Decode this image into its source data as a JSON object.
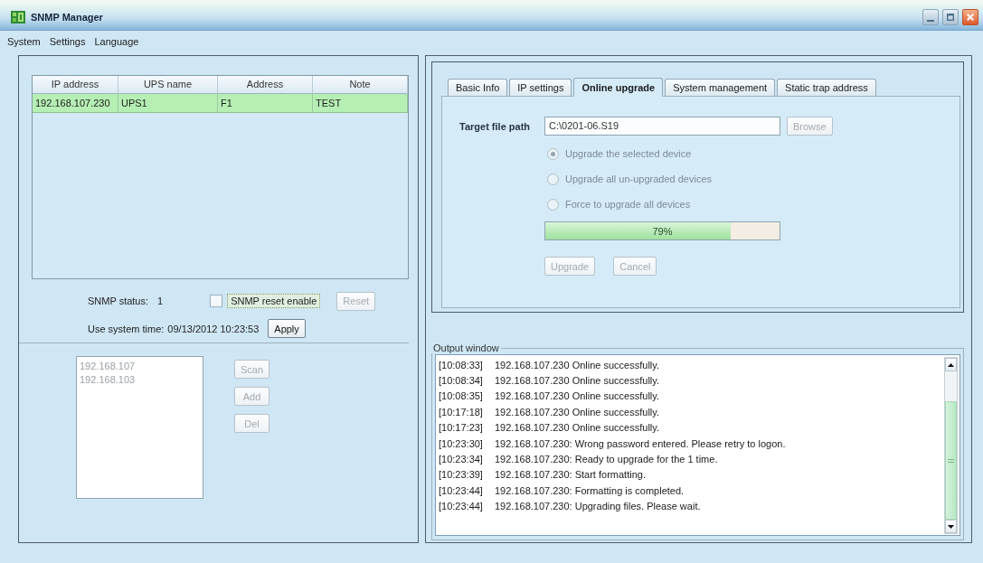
{
  "window": {
    "title": "SNMP Manager"
  },
  "menu": [
    {
      "label": "System"
    },
    {
      "label": "Settings"
    },
    {
      "label": "Language"
    }
  ],
  "device_table": {
    "columns": [
      "IP address",
      "UPS name",
      "Address",
      "Note"
    ],
    "rows": [
      {
        "cells": [
          "192.168.107.230",
          "UPS1",
          "F1",
          "TEST"
        ],
        "selected": true
      }
    ]
  },
  "snmp_status": {
    "label": "SNMP status:",
    "value": "1"
  },
  "reset_enable": {
    "label": "SNMP reset enable",
    "checked": false,
    "focused": true
  },
  "reset_button": {
    "label": "Reset",
    "disabled": true
  },
  "system_time": {
    "label": "Use system time:",
    "value": "09/13/2012 10:23:53"
  },
  "apply_button": {
    "label": "Apply",
    "disabled": false
  },
  "ip_list": {
    "disabled": true,
    "items": [
      "192.168.107",
      "192.168.103"
    ]
  },
  "ip_list_buttons": [
    {
      "label": "Scan",
      "disabled": true
    },
    {
      "label": "Add",
      "disabled": true
    },
    {
      "label": "Del",
      "disabled": true
    }
  ],
  "tabs": [
    {
      "label": "Basic Info",
      "selected": false
    },
    {
      "label": "IP settings",
      "selected": false
    },
    {
      "label": "Online upgrade",
      "selected": true
    },
    {
      "label": "System management",
      "selected": false
    },
    {
      "label": "Static trap address",
      "selected": false
    }
  ],
  "online_upgrade": {
    "target_label": "Target file path",
    "target_value": "C:\\0201-06.S19",
    "browse_button": {
      "label": "Browse",
      "disabled": true
    },
    "options": [
      {
        "label": "Upgrade the selected device",
        "selected": true,
        "disabled": true
      },
      {
        "label": "Upgrade all un-upgraded devices",
        "selected": false,
        "disabled": true
      },
      {
        "label": "Force to upgrade all devices",
        "selected": false,
        "disabled": true
      }
    ],
    "progress": {
      "level": 0.79,
      "reading": "79%"
    },
    "buttons": [
      {
        "label": "Upgrade",
        "disabled": true
      },
      {
        "label": "Cancel",
        "disabled": true
      }
    ]
  },
  "output_window": {
    "title": "Output window",
    "lines": [
      {
        "time": "[10:08:33]",
        "message": "192.168.107.230 Online successfully."
      },
      {
        "time": "[10:08:34]",
        "message": "192.168.107.230 Online successfully."
      },
      {
        "time": "[10:08:35]",
        "message": "192.168.107.230 Online successfully."
      },
      {
        "time": "[10:17:18]",
        "message": "192.168.107.230 Online successfully."
      },
      {
        "time": "[10:17:23]",
        "message": "192.168.107.230 Online successfully."
      },
      {
        "time": "[10:23:30]",
        "message": "192.168.107.230: Wrong password entered. Please retry to logon."
      },
      {
        "time": "[10:23:34]",
        "message": "192.168.107.230: Ready to upgrade for the 1 time."
      },
      {
        "time": "[10:23:39]",
        "message": "192.168.107.230: Start formatting."
      },
      {
        "time": "[10:23:44]",
        "message": "192.168.107.230: Formatting is completed."
      },
      {
        "time": "[10:23:44]",
        "message": "192.168.107.230: Upgrading files. Please wait."
      }
    ]
  }
}
